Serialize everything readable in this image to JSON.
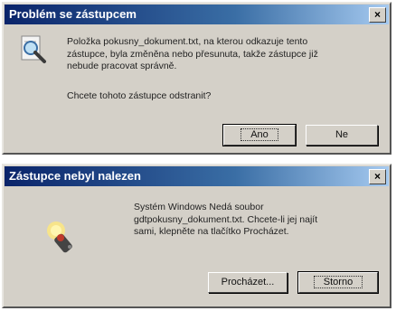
{
  "dialog1": {
    "title": "Problém se zástupcem",
    "close": "×",
    "message_line1": "Položka pokusny_dokument.txt, na kterou odkazuje tento",
    "message_line2": "zástupce, byla změněna nebo přesunuta, takže zástupce již",
    "message_line3": "nebude pracovat správně.",
    "question": "Chcete tohoto zástupce odstranit?",
    "yes_label": "Ano",
    "no_label": "Ne",
    "icon": "search-icon"
  },
  "dialog2": {
    "title": "Zástupce nebyl nalezen",
    "close": "×",
    "message_line1": "Systém Windows Nedá soubor",
    "message_line2": "gdtpokusny_dokument.txt. Chcete-li jej najít",
    "message_line3": "sami, klepněte na tlačítko Procházet.",
    "browse_label": "Procházet...",
    "cancel_label": "Storno",
    "icon": "flashlight-icon"
  }
}
